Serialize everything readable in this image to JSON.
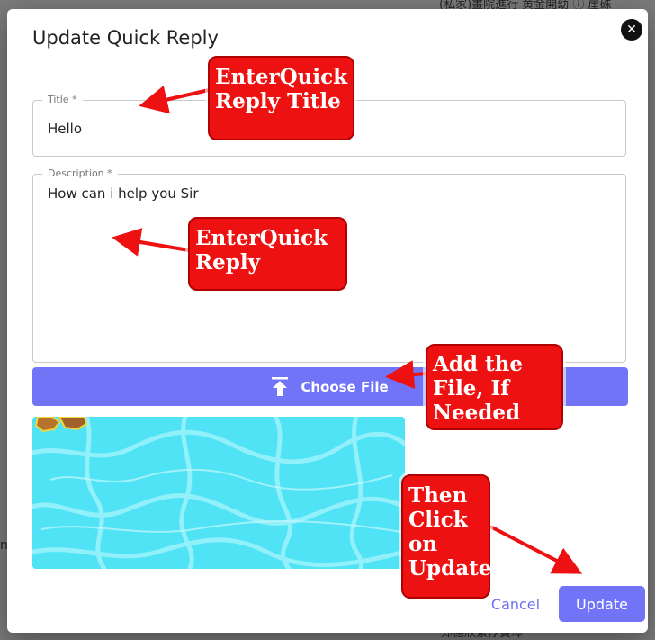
{
  "background": {
    "top_text": "(私家)畫院進行 黄金開幼 ⓘ 崖硃",
    "bottom_text": "郑德欣繁惇寶璋",
    "left_char": "n"
  },
  "modal": {
    "title": "Update Quick Reply",
    "close_icon": "close-icon",
    "title_field": {
      "label": "Title *",
      "value": "Hello"
    },
    "description_field": {
      "label": "Description *",
      "value": "How can i help you Sir"
    },
    "choose_file": {
      "label": "Choose File",
      "icon": "upload-icon"
    },
    "preview": {
      "alt": "water texture image"
    },
    "cancel_label": "Cancel",
    "update_label": "Update"
  },
  "annotations": {
    "title_hint": [
      "EnterQuick",
      "Reply Title"
    ],
    "reply_hint": [
      "EnterQuick",
      "Reply"
    ],
    "file_hint": [
      "Add the",
      "File, If",
      "Needed"
    ],
    "update_hint": [
      "Then",
      "Click",
      "on",
      "Update"
    ]
  },
  "colors": {
    "accent": "#7274f8",
    "callout": "#ee1111",
    "preview_water": "#4fe3f5"
  }
}
